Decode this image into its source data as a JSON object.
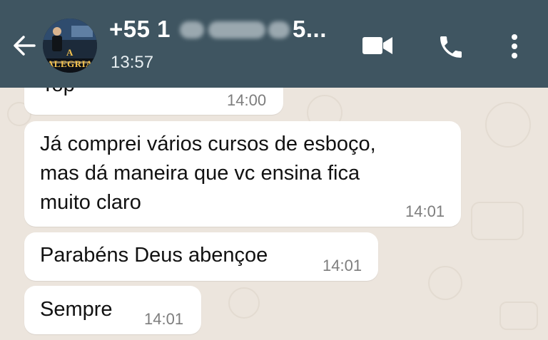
{
  "header": {
    "contact_name": "+55 1",
    "contact_name_suffix": "5...",
    "last_seen": "13:57",
    "avatar_text": "A ALEGRIA"
  },
  "icons": {
    "back": "arrow-left-icon",
    "video": "video-call-icon",
    "phone": "phone-icon",
    "menu": "more-vertical-icon"
  },
  "colors": {
    "header_bg": "#3f5561",
    "chat_bg": "#ece5dd",
    "bubble_bg": "#ffffff"
  },
  "messages": [
    {
      "text": "Top",
      "time": "14:00"
    },
    {
      "lines": [
        "Já comprei vários cursos de esboço,",
        "mas dá maneira que vc ensina fica",
        "muito claro"
      ],
      "time": "14:01"
    },
    {
      "text": "Parabéns Deus abençoe",
      "time": "14:01"
    },
    {
      "text": "Sempre",
      "time": "14:01"
    }
  ]
}
